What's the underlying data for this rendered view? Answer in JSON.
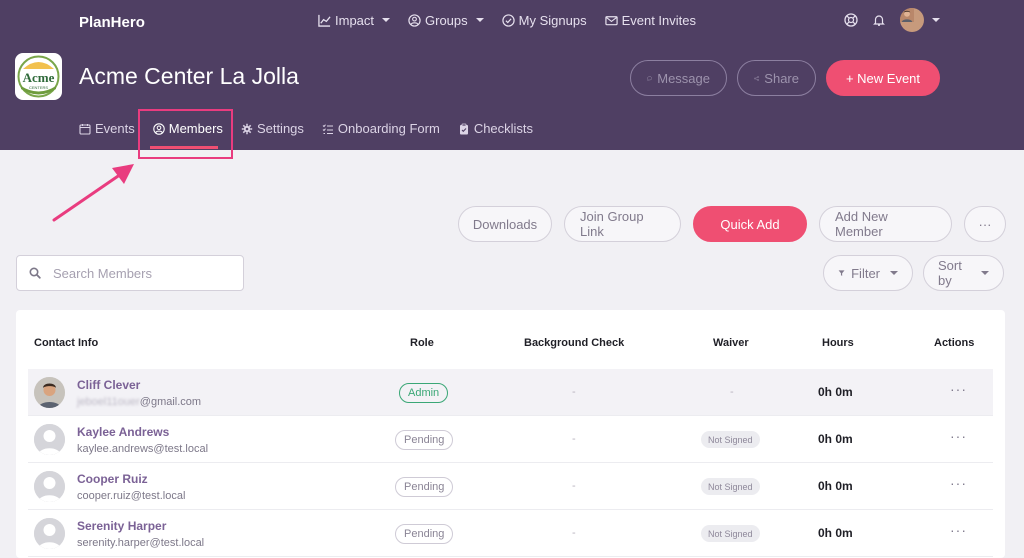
{
  "app": {
    "brand": "PlanHero"
  },
  "nav": {
    "items": [
      {
        "label": "Impact",
        "icon": "chart-line-icon",
        "dropdown": true
      },
      {
        "label": "Groups",
        "icon": "user-circle-icon",
        "dropdown": true
      },
      {
        "label": "My Signups",
        "icon": "check-circle-icon",
        "dropdown": false
      },
      {
        "label": "Event Invites",
        "icon": "envelope-icon",
        "dropdown": false
      }
    ]
  },
  "org": {
    "name": "Acme Center La Jolla",
    "logo_text": "Acme",
    "logo_subtext": "CENTERS"
  },
  "header_buttons": {
    "message": "Message",
    "share": "Share",
    "new_event": "+ New Event"
  },
  "subnav": {
    "items": [
      {
        "label": "Events",
        "icon": "calendar-icon",
        "active": false
      },
      {
        "label": "Members",
        "icon": "user-circle-icon",
        "active": true
      },
      {
        "label": "Settings",
        "icon": "gear-icon",
        "active": false
      },
      {
        "label": "Onboarding Form",
        "icon": "list-check-icon",
        "active": false
      },
      {
        "label": "Checklists",
        "icon": "clipboard-icon",
        "active": false
      }
    ]
  },
  "toolbar": {
    "downloads": "Downloads",
    "join_group_link": "Join Group Link",
    "quick_add": "Quick Add",
    "add_new_member": "Add New Member",
    "more": "···"
  },
  "search": {
    "placeholder": "Search Members",
    "value": ""
  },
  "filters": {
    "filter": "Filter",
    "sort_by": "Sort by"
  },
  "table": {
    "columns": [
      "Contact Info",
      "Role",
      "Background Check",
      "Waiver",
      "Hours",
      "Actions"
    ],
    "rows": [
      {
        "name": "Cliff Clever",
        "email_visible": "@gmail.com",
        "email_hidden": "jeboel11ouer",
        "role": "Admin",
        "background_check": "-",
        "waiver": "-",
        "hours": "0h 0m",
        "actions": "···"
      },
      {
        "name": "Kaylee Andrews",
        "email": "kaylee.andrews@test.local",
        "role": "Pending",
        "background_check": "-",
        "waiver": "Not Signed",
        "hours": "0h 0m",
        "actions": "···"
      },
      {
        "name": "Cooper Ruiz",
        "email": "cooper.ruiz@test.local",
        "role": "Pending",
        "background_check": "-",
        "waiver": "Not Signed",
        "hours": "0h 0m",
        "actions": "···"
      },
      {
        "name": "Serenity Harper",
        "email": "serenity.harper@test.local",
        "role": "Pending",
        "background_check": "-",
        "waiver": "Not Signed",
        "hours": "0h 0m",
        "actions": "···"
      }
    ]
  },
  "colors": {
    "header_bg": "#4f3f63",
    "accent": "#ef4f72",
    "annotation": "#e93c7f",
    "name_link": "#7b6296",
    "admin_green": "#3aa776"
  }
}
